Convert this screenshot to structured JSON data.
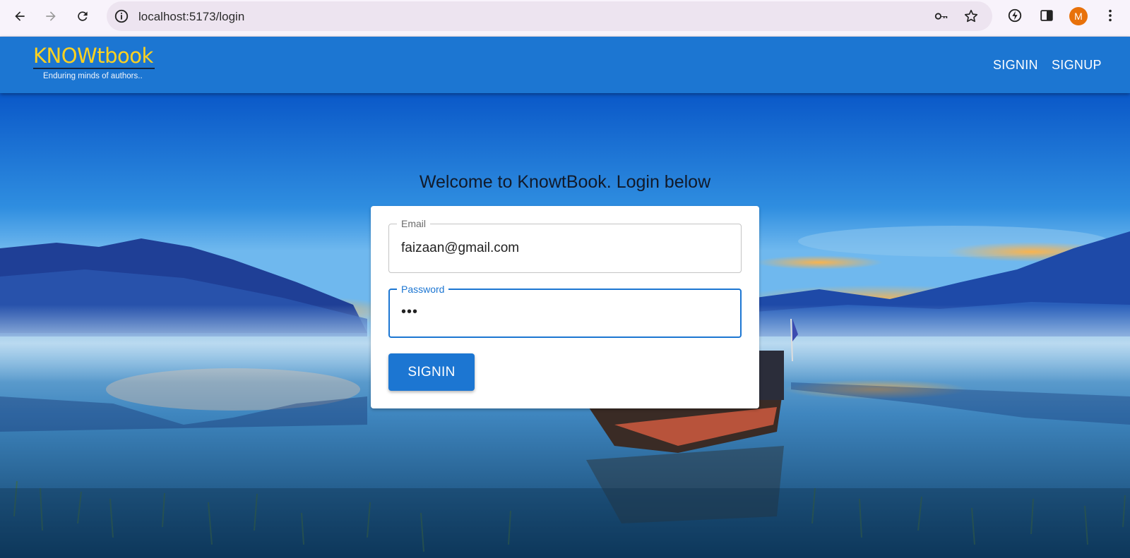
{
  "browser": {
    "url": "localhost:5173/login",
    "profile_initial": "M",
    "icons": [
      "back-icon",
      "forward-icon",
      "reload-icon",
      "site-info-icon",
      "key-icon",
      "star-icon",
      "extension-icon",
      "side-panel-icon",
      "menu-icon"
    ]
  },
  "header": {
    "logo_title": "KNOWtbook",
    "logo_tagline": "Enduring minds of authors..",
    "nav": {
      "signin": "SIGNIN",
      "signup": "SIGNUP"
    },
    "color": "#1c76d2"
  },
  "login": {
    "heading": "Welcome to KnowtBook. Login below",
    "email_label": "Email",
    "email_value": "faizaan@gmail.com",
    "password_label": "Password",
    "password_value": "•••",
    "submit_label": "SIGNIN"
  },
  "colors": {
    "primary": "#1c76d2",
    "logo": "#ffd21f"
  }
}
